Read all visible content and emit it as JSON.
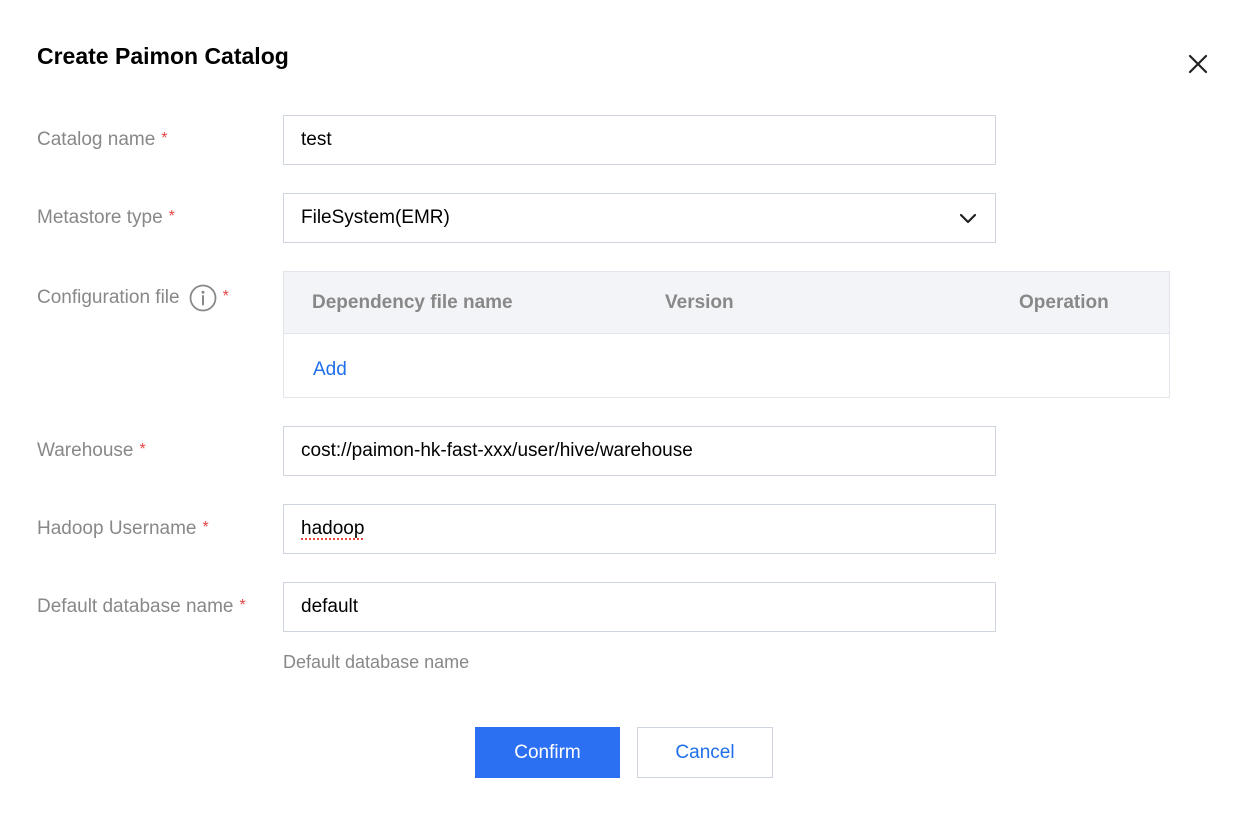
{
  "dialog": {
    "title": "Create Paimon Catalog"
  },
  "form": {
    "required_mark": "*",
    "catalog_name": {
      "label": "Catalog name",
      "value": "test"
    },
    "metastore_type": {
      "label": "Metastore type",
      "value": "FileSystem(EMR)"
    },
    "configuration_file": {
      "label": "Configuration file",
      "columns": [
        "Dependency file name",
        "Version",
        "Operation"
      ],
      "add_label": "Add"
    },
    "warehouse": {
      "label": "Warehouse",
      "value": "cost://paimon-hk-fast-xxx/user/hive/warehouse"
    },
    "hadoop_username": {
      "label": "Hadoop Username",
      "value": "hadoop"
    },
    "default_database": {
      "label": "Default database name",
      "value": "default",
      "hint": "Default database name"
    }
  },
  "actions": {
    "confirm_label": "Confirm",
    "cancel_label": "Cancel"
  },
  "colors": {
    "primary": "#2b6ff3",
    "link": "#1f6fea",
    "required": "#e54545",
    "label_gray": "#888888"
  },
  "icons": {
    "close": "close-icon",
    "info": "info-icon",
    "dropdown": "chevron-down-icon"
  }
}
